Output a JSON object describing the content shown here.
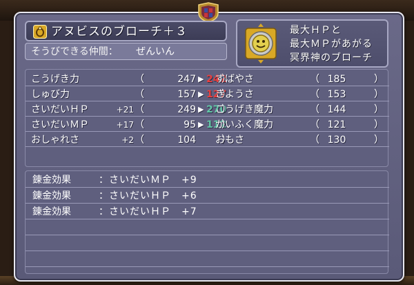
{
  "item": {
    "name": "アヌビスのブローチ＋３",
    "equip_label": "そうびできる仲間：",
    "equip_value": "ぜんいん",
    "description": [
      "最大ＨＰと",
      "最大ＭＰがあがる",
      "冥界神のブローチ"
    ]
  },
  "stats_left": [
    {
      "label": "こうげき力",
      "bonus": "",
      "open": "（",
      "current": "247",
      "arrow": "▶",
      "new": "242",
      "change": "down",
      "close": "）"
    },
    {
      "label": "しゅび力",
      "bonus": "",
      "open": "（",
      "current": "157",
      "arrow": "▶",
      "new": "127",
      "change": "down",
      "close": "）"
    },
    {
      "label": "さいだいＨＰ",
      "bonus": "+21",
      "open": "（",
      "current": "249",
      "arrow": "▶",
      "new": "270",
      "change": "up",
      "close": "）"
    },
    {
      "label": "さいだいＭＰ",
      "bonus": "+17",
      "open": "（",
      "current": "95",
      "arrow": "▶",
      "new": "112",
      "change": "up",
      "close": "）"
    },
    {
      "label": "おしゃれさ",
      "bonus": "+2",
      "open": "（",
      "current": "104",
      "arrow": "",
      "new": "",
      "change": "",
      "close": "）"
    }
  ],
  "stats_right": [
    {
      "label": "すばやさ",
      "open": "（",
      "value": "185",
      "close": "）"
    },
    {
      "label": "きようさ",
      "open": "（",
      "value": "153",
      "close": "）"
    },
    {
      "label": "こうげき魔力",
      "open": "（",
      "value": "144",
      "close": "）"
    },
    {
      "label": "かいふく魔力",
      "open": "（",
      "value": "121",
      "close": "）"
    },
    {
      "label": "おもさ",
      "open": "（",
      "value": "130",
      "close": "）"
    }
  ],
  "effects": [
    {
      "label": "錬金効果",
      "value": "：さいだいＭＰ　+9"
    },
    {
      "label": "錬金効果",
      "value": "：さいだいＨＰ　+6"
    },
    {
      "label": "錬金効果",
      "value": "：さいだいＨＰ　+7"
    },
    {
      "label": "",
      "value": ""
    },
    {
      "label": "",
      "value": ""
    },
    {
      "label": "",
      "value": ""
    }
  ],
  "colors": {
    "stat_up": "#e84040",
    "stat_down": "#63c7a8",
    "panel": "#62617f",
    "gold": "#d9a826"
  },
  "icons": {
    "item_type": "ring-icon",
    "item_image": "anubis-brooch-icon",
    "crest": "crest-icon"
  }
}
